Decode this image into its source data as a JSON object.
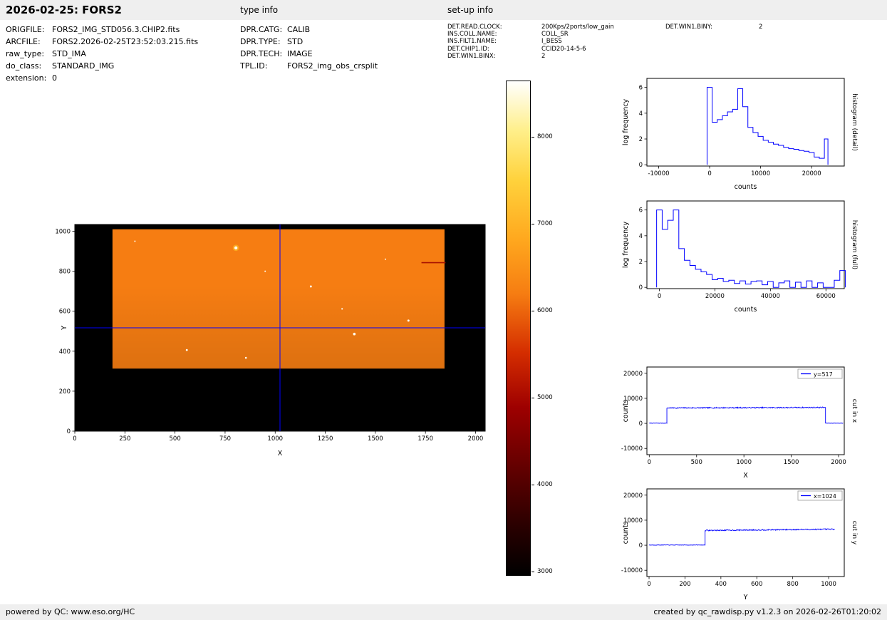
{
  "header": {
    "title": "2026-02-25: FORS2",
    "type_info_label": "type info",
    "setup_info_label": "set-up info"
  },
  "file_info": {
    "rows": [
      {
        "label": "ORIGFILE:",
        "value": "FORS2_IMG_STD056.3.CHIP2.fits"
      },
      {
        "label": "ARCFILE:",
        "value": "FORS2.2026-02-25T23:52:03.215.fits"
      },
      {
        "label": "raw_type:",
        "value": "STD_IMA"
      },
      {
        "label": "do_class:",
        "value": "STANDARD_IMG"
      },
      {
        "label": "extension:",
        "value": "0"
      }
    ]
  },
  "type_info": {
    "rows": [
      {
        "label": "DPR.CATG:",
        "value": "CALIB"
      },
      {
        "label": "DPR.TYPE:",
        "value": "STD"
      },
      {
        "label": "DPR.TECH:",
        "value": "IMAGE"
      },
      {
        "label": "TPL.ID:",
        "value": "FORS2_img_obs_crsplit"
      }
    ]
  },
  "setup_info": {
    "rows": [
      {
        "label": "DET.READ.CLOCK:",
        "value": "200Kps/2ports/low_gain"
      },
      {
        "label": "INS.COLL.NAME:",
        "value": "COLL_SR"
      },
      {
        "label": "INS.FILT1.NAME:",
        "value": "I_BESS"
      },
      {
        "label": "DET.CHIP1.ID:",
        "value": "CCID20-14-5-6"
      },
      {
        "label": "DET.WIN1.BINX:",
        "value": "2"
      }
    ],
    "rows_right": [
      {
        "label": "DET.WIN1.BINY:",
        "value": "2"
      }
    ]
  },
  "footer": {
    "left": "powered by QC: www.eso.org/HC",
    "right": "created by qc_rawdisp.py v1.2.3 on 2026-02-26T01:20:02"
  },
  "colors": {
    "line_blue": "#0000ff",
    "bar_gray": "#efefef",
    "image_background": "#000000",
    "illuminated_orange": "#f67d12"
  },
  "chart_data": [
    {
      "id": "detector_image",
      "type": "heatmap",
      "xlabel": "X",
      "ylabel": "Y",
      "xlim": [
        0,
        2048
      ],
      "ylim": [
        0,
        1034
      ],
      "xticks": [
        0,
        250,
        500,
        750,
        1000,
        1250,
        1500,
        1750,
        2000
      ],
      "yticks": [
        0,
        200,
        400,
        600,
        800,
        1000
      ],
      "background_counts": 3000,
      "background_color": "#000000",
      "illuminated_region": {
        "x0": 188,
        "x1": 1845,
        "y0": 313,
        "y1": 1010,
        "mean_counts": 6200,
        "color": "#f67d12"
      },
      "crosshair": {
        "x": 1024,
        "y": 517,
        "color": "#0000ff"
      },
      "streak": {
        "x0": 1730,
        "x1": 1850,
        "y": 843,
        "color": "#a81200"
      },
      "stars": [
        {
          "x": 804,
          "y": 917,
          "r": 2.2,
          "halo": true
        },
        {
          "x": 1178,
          "y": 724,
          "r": 1.4,
          "halo": false
        },
        {
          "x": 1665,
          "y": 553,
          "r": 1.5,
          "halo": false
        },
        {
          "x": 1395,
          "y": 486,
          "r": 1.8,
          "halo": false
        },
        {
          "x": 559,
          "y": 406,
          "r": 1.4,
          "halo": false
        },
        {
          "x": 854,
          "y": 367,
          "r": 1.3,
          "halo": false
        },
        {
          "x": 1334,
          "y": 612,
          "r": 1.1,
          "halo": false
        },
        {
          "x": 300,
          "y": 950,
          "r": 1.0,
          "halo": false
        },
        {
          "x": 950,
          "y": 800,
          "r": 1.0,
          "halo": false
        },
        {
          "x": 1550,
          "y": 860,
          "r": 1.0,
          "halo": false
        }
      ]
    },
    {
      "id": "colorbar",
      "type": "colorbar",
      "vmin": 2950,
      "vmax": 8650,
      "ticks": [
        3000,
        4000,
        5000,
        6000,
        7000,
        8000
      ],
      "gradient_stops": [
        {
          "pos": 0.0,
          "color": "#000000"
        },
        {
          "pos": 0.1,
          "color": "#2a0000"
        },
        {
          "pos": 0.22,
          "color": "#640000"
        },
        {
          "pos": 0.34,
          "color": "#9e0000"
        },
        {
          "pos": 0.45,
          "color": "#d42d00"
        },
        {
          "pos": 0.57,
          "color": "#f67d12"
        },
        {
          "pos": 0.68,
          "color": "#ffa81e"
        },
        {
          "pos": 0.8,
          "color": "#ffd23c"
        },
        {
          "pos": 0.9,
          "color": "#ffef8a"
        },
        {
          "pos": 1.0,
          "color": "#ffffff"
        }
      ]
    },
    {
      "id": "histogram_detail",
      "type": "bar",
      "style": "step-histogram",
      "title_right": "histogram (detail)",
      "xlabel": "counts",
      "ylabel": "log frequency",
      "xlim": [
        -12300,
        26400
      ],
      "ylim": [
        -0.1,
        6.7
      ],
      "xticks": [
        -10000,
        0,
        10000,
        20000
      ],
      "yticks": [
        0,
        2,
        4,
        6
      ],
      "line_color": "#0000ff",
      "bin_edges": [
        -500,
        500,
        1500,
        2500,
        3500,
        4500,
        5500,
        6500,
        7500,
        8500,
        9500,
        10500,
        11500,
        12500,
        13500,
        14500,
        15500,
        16500,
        17500,
        18500,
        19500,
        20500,
        21500,
        22500,
        23200
      ],
      "values": [
        6.0,
        3.3,
        3.5,
        3.8,
        4.1,
        4.3,
        5.9,
        4.5,
        2.9,
        2.5,
        2.2,
        1.9,
        1.75,
        1.6,
        1.5,
        1.35,
        1.25,
        1.2,
        1.1,
        1.05,
        0.95,
        0.6,
        0.5,
        2.0
      ]
    },
    {
      "id": "histogram_full",
      "type": "bar",
      "style": "step-histogram",
      "title_right": "histogram (full)",
      "xlabel": "counts",
      "ylabel": "log frequency",
      "xlim": [
        -4500,
        66600
      ],
      "ylim": [
        -0.1,
        6.7
      ],
      "xticks": [
        0,
        20000,
        40000,
        60000
      ],
      "yticks": [
        0,
        2,
        4,
        6
      ],
      "line_color": "#0000ff",
      "bin_edges": [
        -1000,
        1000,
        3000,
        5000,
        7000,
        9000,
        11000,
        13000,
        15000,
        17000,
        19000,
        21000,
        23000,
        25000,
        27000,
        29000,
        31000,
        33000,
        35000,
        37000,
        39000,
        41000,
        43000,
        45000,
        47000,
        49000,
        51000,
        53000,
        55000,
        57000,
        59000,
        61000,
        63000,
        65000,
        67000
      ],
      "values": [
        6.0,
        4.5,
        5.2,
        6.0,
        3.0,
        2.1,
        1.7,
        1.4,
        1.2,
        1.0,
        0.6,
        0.7,
        0.45,
        0.55,
        0.3,
        0.5,
        0.25,
        0.45,
        0.5,
        0.2,
        0.45,
        0,
        0.35,
        0.5,
        0,
        0.4,
        0,
        0.5,
        0,
        0.35,
        0,
        0,
        0.55,
        1.3
      ]
    },
    {
      "id": "cut_in_x",
      "type": "line",
      "title_right": "cut in x",
      "legend": "y=517",
      "xlabel": "X",
      "ylabel": "counts",
      "xlim": [
        -25,
        2060
      ],
      "ylim": [
        -12500,
        22500
      ],
      "xticks": [
        0,
        500,
        1000,
        1500,
        2000
      ],
      "yticks": [
        -10000,
        0,
        10000,
        20000
      ],
      "line_color": "#0000ff",
      "segments": [
        {
          "x0": 0,
          "x1": 186,
          "y0": 80,
          "y1": 80,
          "noise": 80
        },
        {
          "x0": 186,
          "x1": 1862,
          "y0": 6150,
          "y1": 6350,
          "noise": 220
        },
        {
          "x0": 1862,
          "x1": 2048,
          "y0": 80,
          "y1": 80,
          "noise": 80
        }
      ]
    },
    {
      "id": "cut_in_y",
      "type": "line",
      "title_right": "cut in y",
      "legend": "x=1024",
      "xlabel": "Y",
      "ylabel": "counts",
      "xlim": [
        -12,
        1087
      ],
      "ylim": [
        -12500,
        22500
      ],
      "xticks": [
        0,
        200,
        400,
        600,
        800,
        1000
      ],
      "yticks": [
        -10000,
        0,
        10000,
        20000
      ],
      "line_color": "#0000ff",
      "segments": [
        {
          "x0": 0,
          "x1": 312,
          "y0": 80,
          "y1": 80,
          "noise": 80
        },
        {
          "x0": 312,
          "x1": 1034,
          "y0": 5900,
          "y1": 6400,
          "noise": 220
        }
      ]
    }
  ]
}
